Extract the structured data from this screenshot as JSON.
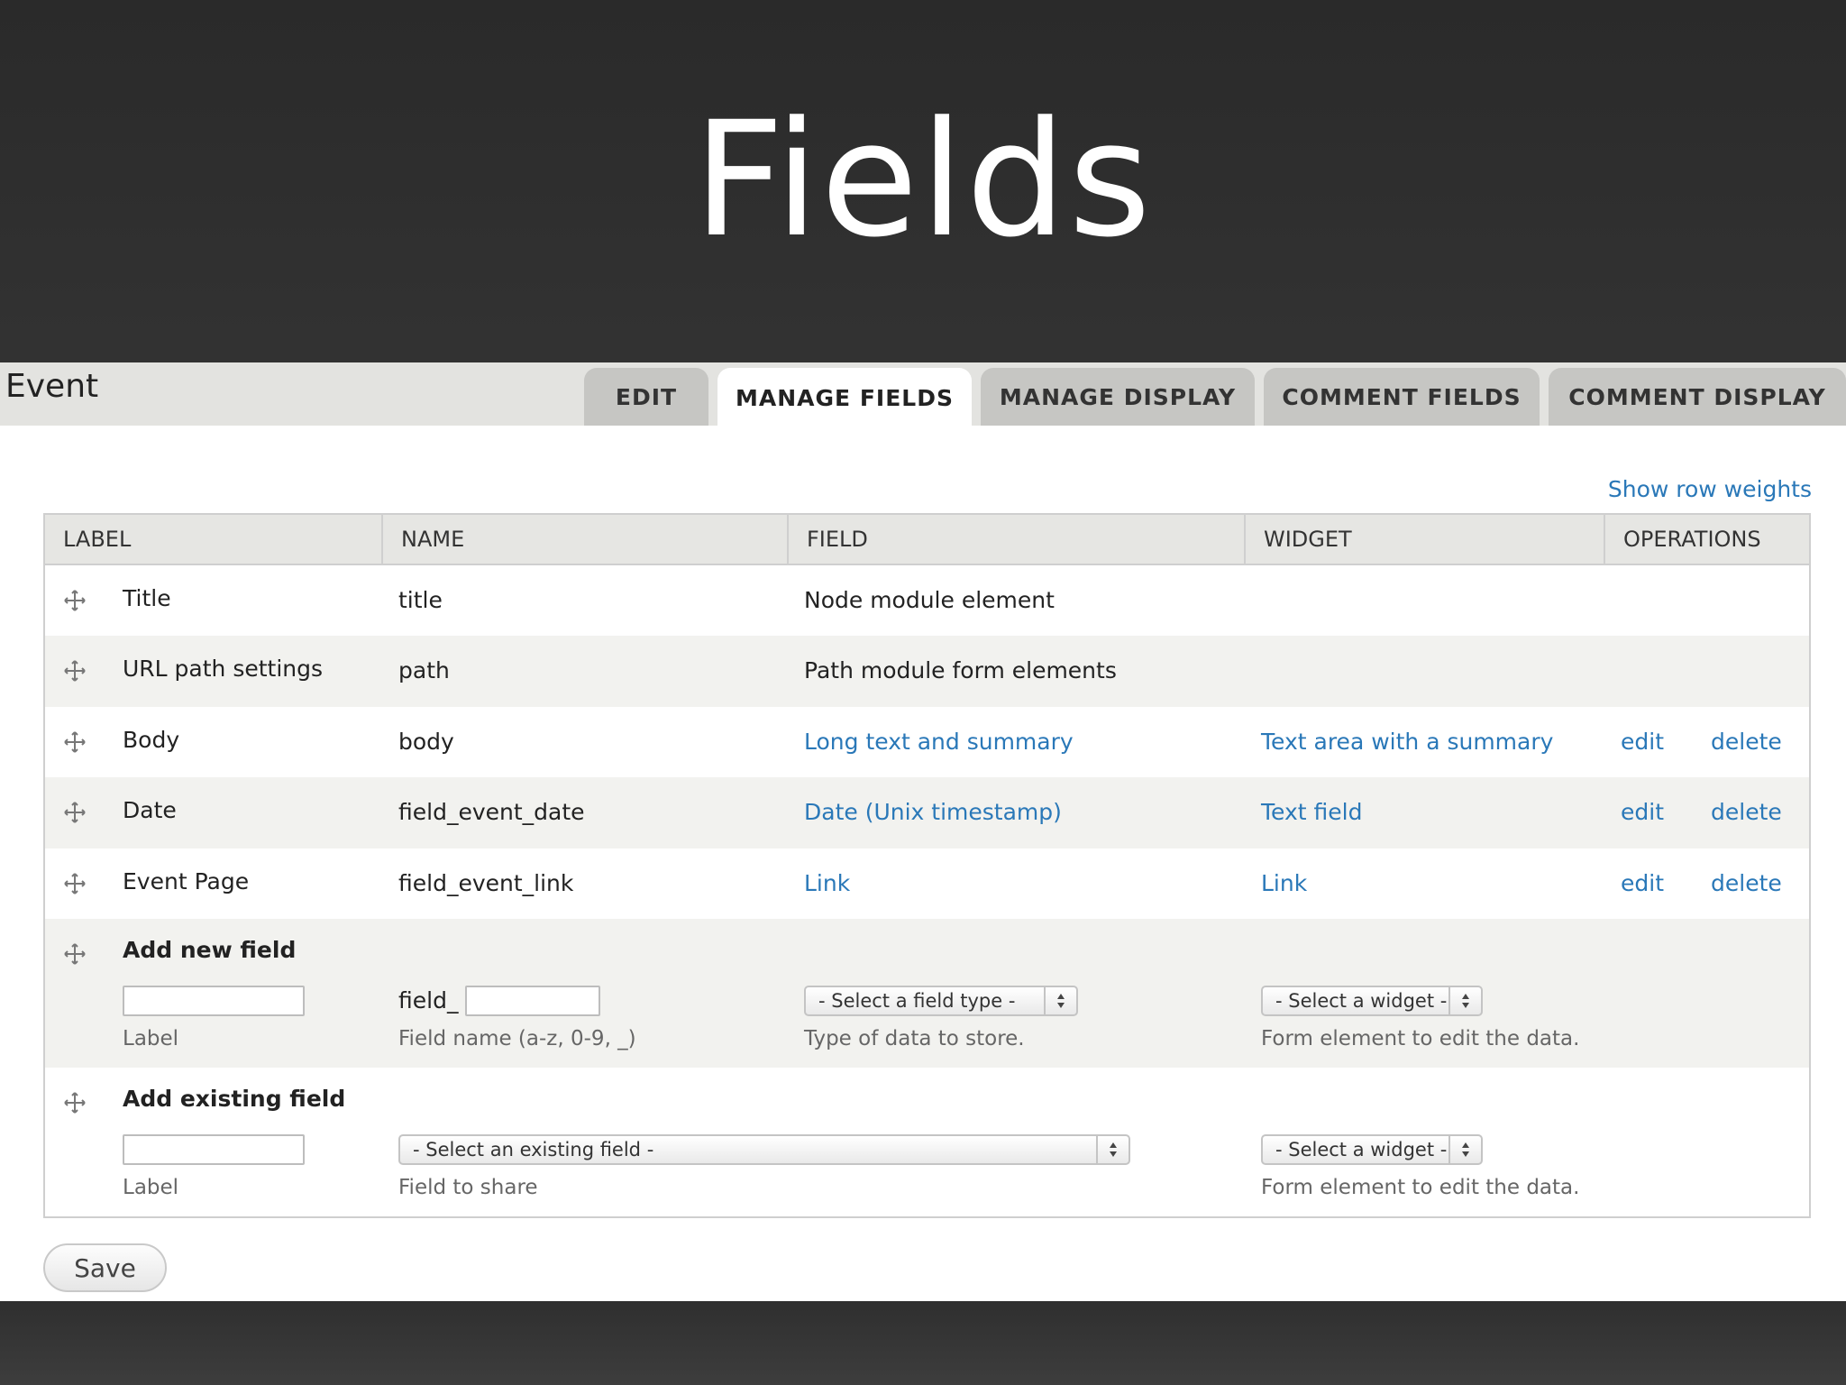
{
  "slide": {
    "title": "Fields"
  },
  "page": {
    "title": "Event"
  },
  "tabs": [
    {
      "label": "EDIT",
      "active": false
    },
    {
      "label": "MANAGE FIELDS",
      "active": true
    },
    {
      "label": "MANAGE DISPLAY",
      "active": false
    },
    {
      "label": "COMMENT FIELDS",
      "active": false
    },
    {
      "label": "COMMENT DISPLAY",
      "active": false
    }
  ],
  "show_row_weights": "Show row weights",
  "table": {
    "headers": [
      "LABEL",
      "NAME",
      "FIELD",
      "WIDGET",
      "OPERATIONS"
    ],
    "rows": [
      {
        "label": "Title",
        "name": "title",
        "field": "Node module element",
        "widget": "",
        "edit": "",
        "delete": ""
      },
      {
        "label": "URL path settings",
        "name": "path",
        "field": "Path module form elements",
        "widget": "",
        "edit": "",
        "delete": ""
      },
      {
        "label": "Body",
        "name": "body",
        "field": "Long text and summary",
        "widget": "Text area with a summary",
        "edit": "edit",
        "delete": "delete"
      },
      {
        "label": "Date",
        "name": "field_event_date",
        "field": "Date (Unix timestamp)",
        "widget": "Text field",
        "edit": "edit",
        "delete": "delete"
      },
      {
        "label": "Event Page",
        "name": "field_event_link",
        "field": "Link",
        "widget": "Link",
        "edit": "edit",
        "delete": "delete"
      }
    ],
    "add_new": {
      "title": "Add new field",
      "label_desc": "Label",
      "name_prefix": "field_",
      "name_desc": "Field name (a-z, 0-9, _)",
      "type_select": "- Select a field type -",
      "type_desc": "Type of data to store.",
      "widget_select": "- Select a widget -",
      "widget_desc": "Form element to edit the data."
    },
    "add_existing": {
      "title": "Add existing field",
      "label_desc": "Label",
      "field_select": "- Select an existing field -",
      "field_desc": "Field to share",
      "widget_select": "- Select a widget -",
      "widget_desc": "Form element to edit the data."
    }
  },
  "save_label": "Save",
  "colors": {
    "link": "#2a78b8",
    "header_bg": "#e3e3e0",
    "tab_bg": "#c6c6c3"
  }
}
